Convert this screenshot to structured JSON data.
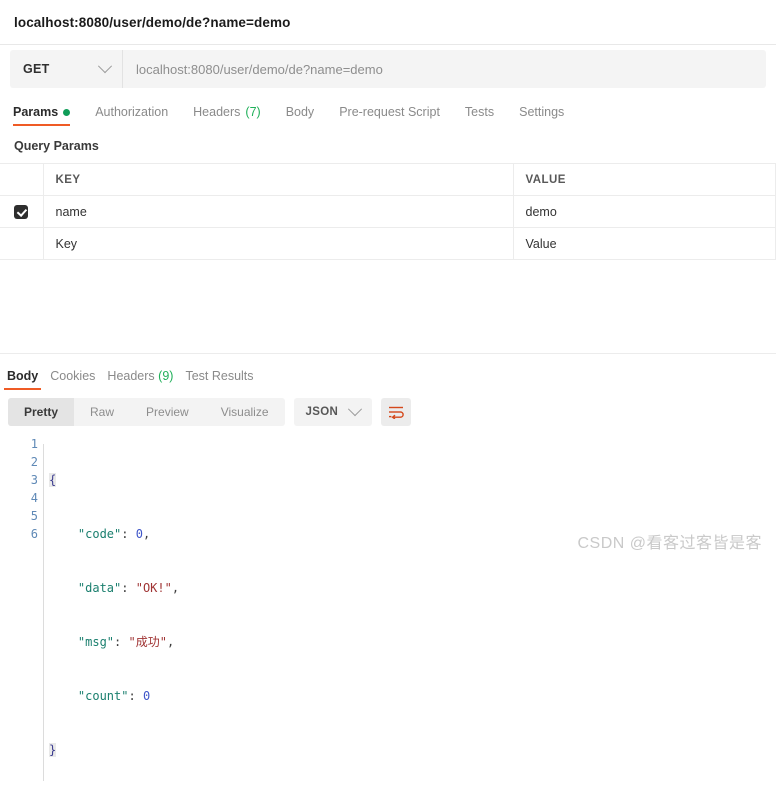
{
  "window": {
    "title": "localhost:8080/user/demo/de?name=demo"
  },
  "request": {
    "method": "GET",
    "url": "localhost:8080/user/demo/de?name=demo",
    "tabs": [
      {
        "label": "Params",
        "badge": "dot",
        "active": true
      },
      {
        "label": "Authorization",
        "badge": "",
        "active": false
      },
      {
        "label": "Headers",
        "badge": "(7)",
        "active": false
      },
      {
        "label": "Body",
        "badge": "",
        "active": false
      },
      {
        "label": "Pre-request Script",
        "badge": "",
        "active": false
      },
      {
        "label": "Tests",
        "badge": "",
        "active": false
      },
      {
        "label": "Settings",
        "badge": "",
        "active": false
      }
    ],
    "section_title": "Query Params",
    "table": {
      "headers": [
        "KEY",
        "VALUE"
      ],
      "rows": [
        {
          "checked": true,
          "key": "name",
          "value": "demo"
        }
      ],
      "empty_row": {
        "key_placeholder": "Key",
        "value_placeholder": "Value"
      }
    }
  },
  "response": {
    "tabs": [
      {
        "label": "Body",
        "badge": "",
        "active": true
      },
      {
        "label": "Cookies",
        "badge": "",
        "active": false
      },
      {
        "label": "Headers",
        "badge": "(9)",
        "active": false
      },
      {
        "label": "Test Results",
        "badge": "",
        "active": false
      }
    ],
    "view_modes": [
      {
        "label": "Pretty",
        "active": true
      },
      {
        "label": "Raw",
        "active": false
      },
      {
        "label": "Preview",
        "active": false
      },
      {
        "label": "Visualize",
        "active": false
      }
    ],
    "format": "JSON",
    "body_lines": [
      {
        "n": "1",
        "text": "{"
      },
      {
        "n": "2",
        "text": "    \"code\": 0,"
      },
      {
        "n": "3",
        "text": "    \"data\": \"OK!\","
      },
      {
        "n": "4",
        "text": "    \"msg\": \"成功\","
      },
      {
        "n": "5",
        "text": "    \"count\": 0"
      },
      {
        "n": "6",
        "text": "}"
      }
    ],
    "body_json": {
      "code": 0,
      "data": "OK!",
      "msg": "成功",
      "count": 0
    }
  },
  "watermark": "CSDN @看客过客皆是客",
  "colors": {
    "accent": "#ef5b25",
    "badge_green": "#20b05a",
    "dot_green": "#0f9d58",
    "json_key": "#1a7f6e",
    "json_string": "#a03434",
    "json_number": "#3f56c9",
    "gutter": "#5f89b6"
  }
}
